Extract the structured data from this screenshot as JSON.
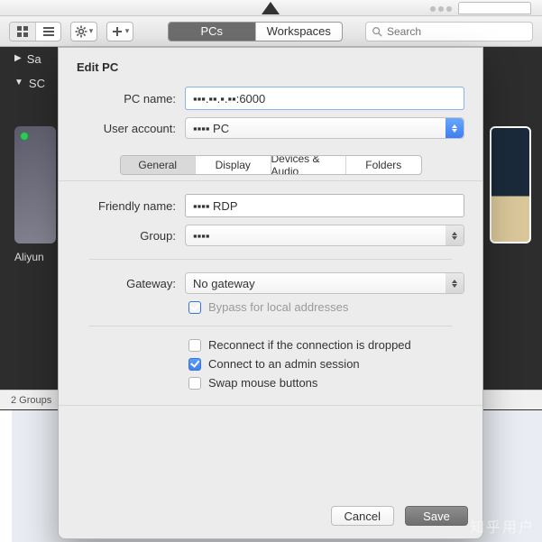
{
  "toolbar": {
    "segTabs": [
      "PCs",
      "Workspaces"
    ],
    "searchPlaceholder": "Search"
  },
  "background": {
    "group1": "Sa",
    "group2": "SC",
    "thumb1Caption": "Aliyun",
    "footer": "2 Groups"
  },
  "dialog": {
    "title": "Edit PC",
    "labels": {
      "pcName": "PC name:",
      "userAccount": "User account:",
      "friendlyName": "Friendly name:",
      "group": "Group:",
      "gateway": "Gateway:"
    },
    "values": {
      "pcName": "▪▪▪.▪▪.▪.▪▪:6000",
      "userAccount": "▪▪▪▪ PC",
      "friendlyName": "▪▪▪▪ RDP",
      "group": "▪▪▪▪",
      "gateway": "No gateway"
    },
    "tabs": [
      "General",
      "Display",
      "Devices & Audio",
      "Folders"
    ],
    "checks": {
      "bypass": "Bypass for local addresses",
      "reconnect": "Reconnect if the connection is dropped",
      "admin": "Connect to an admin session",
      "swap": "Swap mouse buttons"
    },
    "buttons": {
      "cancel": "Cancel",
      "save": "Save"
    }
  },
  "watermark": "知乎用户"
}
